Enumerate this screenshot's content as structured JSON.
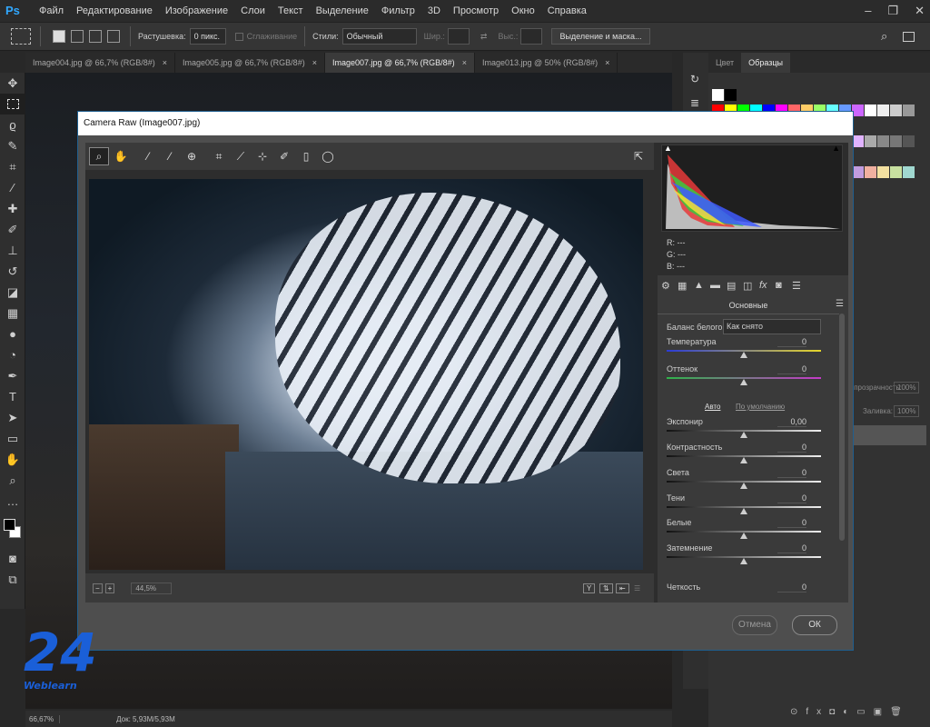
{
  "menubar": {
    "app_logo": "Ps",
    "items": [
      "Файл",
      "Редактирование",
      "Изображение",
      "Слои",
      "Текст",
      "Выделение",
      "Фильтр",
      "3D",
      "Просмотр",
      "Окно",
      "Справка"
    ]
  },
  "options": {
    "feather_label": "Растушевка:",
    "feather_value": "0 пикс.",
    "antialias_label": "Сглаживание",
    "style_label": "Стили:",
    "style_value": "Обычный",
    "width_label": "Шир.:",
    "height_label": "Выс.:",
    "select_mask_button": "Выделение и маска..."
  },
  "tabs": [
    {
      "label": "Image004.jpg @ 66,7% (RGB/8#)"
    },
    {
      "label": "Image005.jpg @ 66,7% (RGB/8#)"
    },
    {
      "label": "Image007.jpg @ 66,7% (RGB/8#)"
    },
    {
      "label": "Image013.jpg @ 50% (RGB/8#)"
    }
  ],
  "tab_close": "×",
  "status": {
    "zoom": "66,67%",
    "doc": "Док: 5,93M/5,93M"
  },
  "right_panel": {
    "tab_color": "Цвет",
    "tab_swatches": "Образцы",
    "opacity_label": "Непрозрачность:",
    "opacity_value": "100%",
    "fill_label": "Заливка:",
    "fill_value": "100%"
  },
  "dialog": {
    "title": "Camera Raw (Image007.jpg)",
    "zoom_value": "44,5%",
    "hist_r": "R:  ---",
    "hist_g": "G:  ---",
    "hist_b": "B:  ---",
    "panel_title": "Основные",
    "wb_label": "Баланс белого:",
    "wb_value": "Как снято",
    "auto": "Авто",
    "default": "По умолчанию",
    "cancel": "Отмена",
    "ok": "ОК",
    "sliders": [
      {
        "label": "Температура",
        "value": "0"
      },
      {
        "label": "Оттенок",
        "value": "0"
      },
      {
        "label": "Экспонир",
        "value": "0,00"
      },
      {
        "label": "Контрастность",
        "value": "0"
      },
      {
        "label": "Света",
        "value": "0"
      },
      {
        "label": "Тени",
        "value": "0"
      },
      {
        "label": "Белые",
        "value": "0"
      },
      {
        "label": "Затемнение",
        "value": "0"
      },
      {
        "label": "Четкость",
        "value": "0"
      }
    ]
  },
  "watermark": {
    "brand": "Weblearn",
    "number": "24"
  },
  "colors": {
    "accent": "#31a8ff",
    "dialog_border": "#1f5f8f"
  },
  "icons": [
    "move-icon",
    "marquee-icon",
    "lasso-icon",
    "quick-select-icon",
    "crop-icon",
    "eyedropper-icon",
    "healing-icon",
    "brush-icon",
    "stamp-icon",
    "history-brush-icon",
    "eraser-icon",
    "gradient-icon",
    "blur-icon",
    "dodge-icon",
    "pen-icon",
    "type-icon",
    "path-select-icon",
    "shape-icon",
    "hand-icon",
    "zoom-icon"
  ]
}
